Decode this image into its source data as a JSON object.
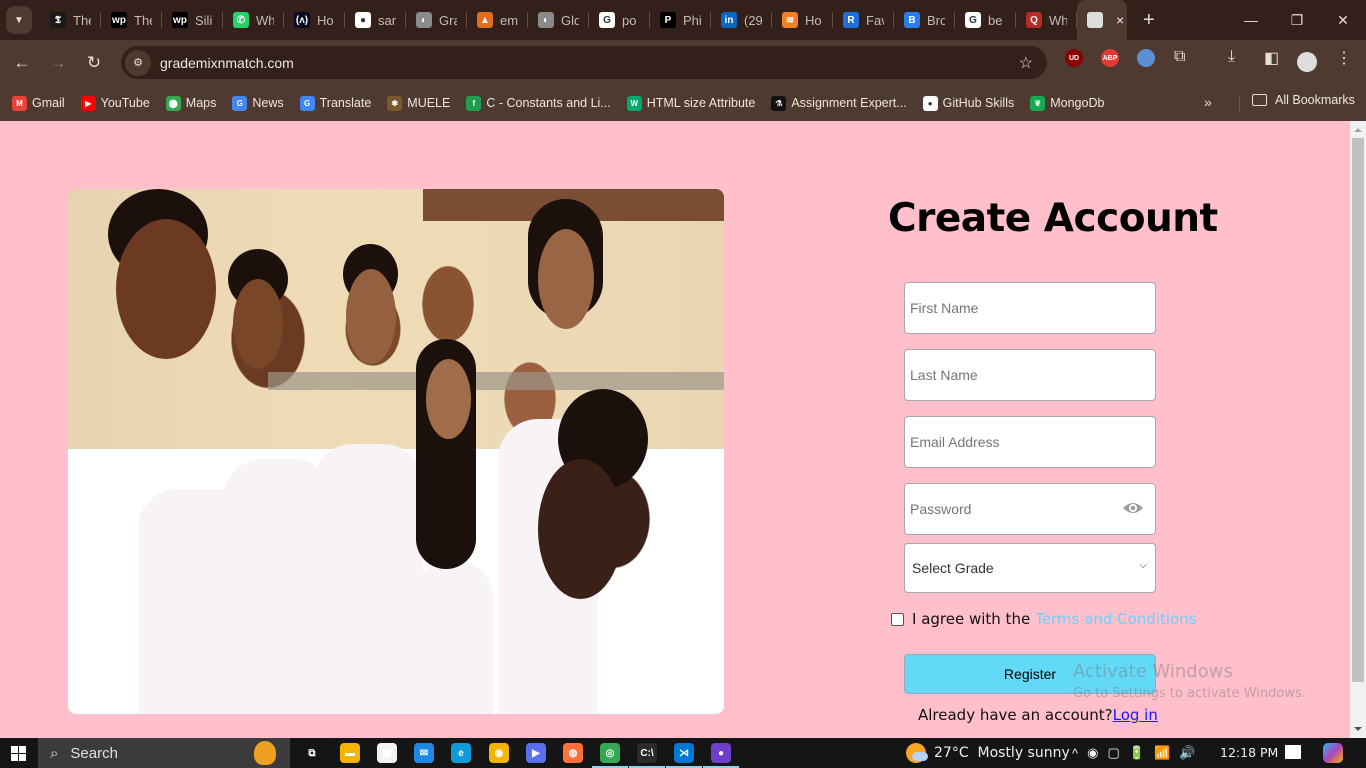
{
  "browser": {
    "tabs": [
      {
        "title": "The",
        "favicon": "nyt-icon",
        "color": "#1a1a1a",
        "glyph": "𝕿"
      },
      {
        "title": "The",
        "favicon": "washington-post-icon",
        "color": "#000000",
        "glyph": "wp"
      },
      {
        "title": "Sili",
        "favicon": "washington-post-icon",
        "color": "#000000",
        "glyph": "wp"
      },
      {
        "title": "Wh",
        "favicon": "whatsapp-icon",
        "color": "#25d366",
        "glyph": "✆"
      },
      {
        "title": "Ho",
        "favicon": "freecodecamp-icon",
        "color": "#0a0a23",
        "glyph": "(ʌ)"
      },
      {
        "title": "sar",
        "favicon": "github-icon",
        "color": "#ffffff",
        "glyph": "●"
      },
      {
        "title": "Gra",
        "favicon": "globe-icon",
        "color": "#8a8a8a",
        "glyph": "◐"
      },
      {
        "title": "em",
        "favicon": "app-icon",
        "color": "#e07020",
        "glyph": "▲"
      },
      {
        "title": "Glo",
        "favicon": "globe-icon",
        "color": "#8a8a8a",
        "glyph": "◐"
      },
      {
        "title": "po",
        "favicon": "google-icon",
        "color": "#ffffff",
        "glyph": "G"
      },
      {
        "title": "Phi",
        "favicon": "p-icon",
        "color": "#000000",
        "glyph": "P"
      },
      {
        "title": "(29",
        "favicon": "linkedin-icon",
        "color": "#0a66c2",
        "glyph": "in"
      },
      {
        "title": "Ho",
        "favicon": "stackoverflow-icon",
        "color": "#f48024",
        "glyph": "≋"
      },
      {
        "title": "Fav",
        "favicon": "r-icon",
        "color": "#1e6fd9",
        "glyph": "R"
      },
      {
        "title": "Bro",
        "favicon": "brand-icon",
        "color": "#2b7de9",
        "glyph": "B"
      },
      {
        "title": "be",
        "favicon": "google-icon",
        "color": "#ffffff",
        "glyph": "G"
      },
      {
        "title": "Wh",
        "favicon": "quora-icon",
        "color": "#b92b27",
        "glyph": "Q"
      }
    ],
    "active_tab": {
      "favicon": "site-logo-icon",
      "close": "×"
    },
    "new_tab": "+",
    "window": {
      "minimize": "—",
      "restore": "❐",
      "close": "✕"
    },
    "nav": {
      "back": "←",
      "forward": "→",
      "reload": "↻"
    },
    "url": "grademixnmatch.com",
    "extensions": [
      {
        "name": "ublock-icon",
        "label": "UD",
        "color": "#8b0000"
      },
      {
        "name": "adblock-plus-icon",
        "label": "ABP",
        "color": "#e53935"
      },
      {
        "name": "globe-extension-icon",
        "label": "",
        "color": "#5b8fd4"
      }
    ],
    "bookmarks": [
      {
        "label": "Gmail",
        "icon": "gmail-icon",
        "color": "#ea4335",
        "glyph": "M"
      },
      {
        "label": "YouTube",
        "icon": "youtube-icon",
        "color": "#ff0000",
        "glyph": "▶"
      },
      {
        "label": "Maps",
        "icon": "maps-icon",
        "color": "#34a853",
        "glyph": "⬤"
      },
      {
        "label": "News",
        "icon": "news-icon",
        "color": "#4285f4",
        "glyph": "G"
      },
      {
        "label": "Translate",
        "icon": "translate-icon",
        "color": "#4285f4",
        "glyph": "G"
      },
      {
        "label": "MUELE",
        "icon": "muele-icon",
        "color": "#7a5a2a",
        "glyph": "✱"
      },
      {
        "label": "C - Constants and Li...",
        "icon": "c-icon",
        "color": "#1e9e50",
        "glyph": "f"
      },
      {
        "label": "HTML size Attribute",
        "icon": "w3schools-icon",
        "color": "#04aa6d",
        "glyph": "W"
      },
      {
        "label": "Assignment Expert...",
        "icon": "assignment-icon",
        "color": "#111111",
        "glyph": "⚗"
      },
      {
        "label": "GitHub Skills",
        "icon": "github-icon",
        "color": "#ffffff",
        "glyph": "●"
      },
      {
        "label": "MongoDb",
        "icon": "mongodb-icon",
        "color": "#13aa52",
        "glyph": "❦"
      }
    ],
    "bookmarks_more": "»",
    "all_bookmarks": "All Bookmarks"
  },
  "page": {
    "hero_image": "children-group-photo",
    "title": "Create Account",
    "fields": {
      "first_name": {
        "placeholder": "First Name",
        "value": ""
      },
      "last_name": {
        "placeholder": "Last Name",
        "value": ""
      },
      "email": {
        "placeholder": "Email Address",
        "value": ""
      },
      "password": {
        "placeholder": "Password",
        "value": ""
      }
    },
    "grade_select": {
      "selected": "Select Grade"
    },
    "agree_text": "I agree with the",
    "terms_link": "Terms and Conditions",
    "agree_checked": false,
    "register_label": "Register",
    "login_prompt": "Already have an account?",
    "login_link": "Log in",
    "colors": {
      "background": "#ffbfcb",
      "register": "#62d9f7",
      "terms": "#69d2ff",
      "login": "#1a1aff"
    }
  },
  "watermark": {
    "line1": "Activate Windows",
    "line2": "Go to Settings to activate Windows."
  },
  "taskbar": {
    "search_label": "Search",
    "apps": [
      {
        "name": "task-view-icon",
        "color": "#151515",
        "glyph": "⧉"
      },
      {
        "name": "file-explorer-icon",
        "color": "#f4b400",
        "glyph": "▬"
      },
      {
        "name": "microsoft-store-icon",
        "color": "#f3f3f3",
        "glyph": "▦"
      },
      {
        "name": "mail-icon",
        "color": "#1e88e5",
        "glyph": "✉"
      },
      {
        "name": "edge-icon",
        "color": "#0f9bd7",
        "glyph": "e"
      },
      {
        "name": "vpn-icon",
        "color": "#f5b400",
        "glyph": "◉"
      },
      {
        "name": "video-app-icon",
        "color": "#5a6ef0",
        "glyph": "▶"
      },
      {
        "name": "firefox-icon",
        "color": "#ff7139",
        "glyph": "◍"
      },
      {
        "name": "chrome-icon",
        "color": "#34a853",
        "glyph": "◎"
      },
      {
        "name": "terminal-icon",
        "color": "#2b2b2b",
        "glyph": "C:\\"
      },
      {
        "name": "vscode-icon",
        "color": "#0078d4",
        "glyph": "⋊"
      },
      {
        "name": "github-desktop-icon",
        "color": "#6e40c9",
        "glyph": "●"
      }
    ],
    "weather": {
      "temp": "27°C",
      "condition": "Mostly sunny"
    },
    "tray": [
      "^",
      "◉",
      "▢",
      "🔋",
      "📶",
      "🔊"
    ],
    "time": "12:18 PM"
  }
}
